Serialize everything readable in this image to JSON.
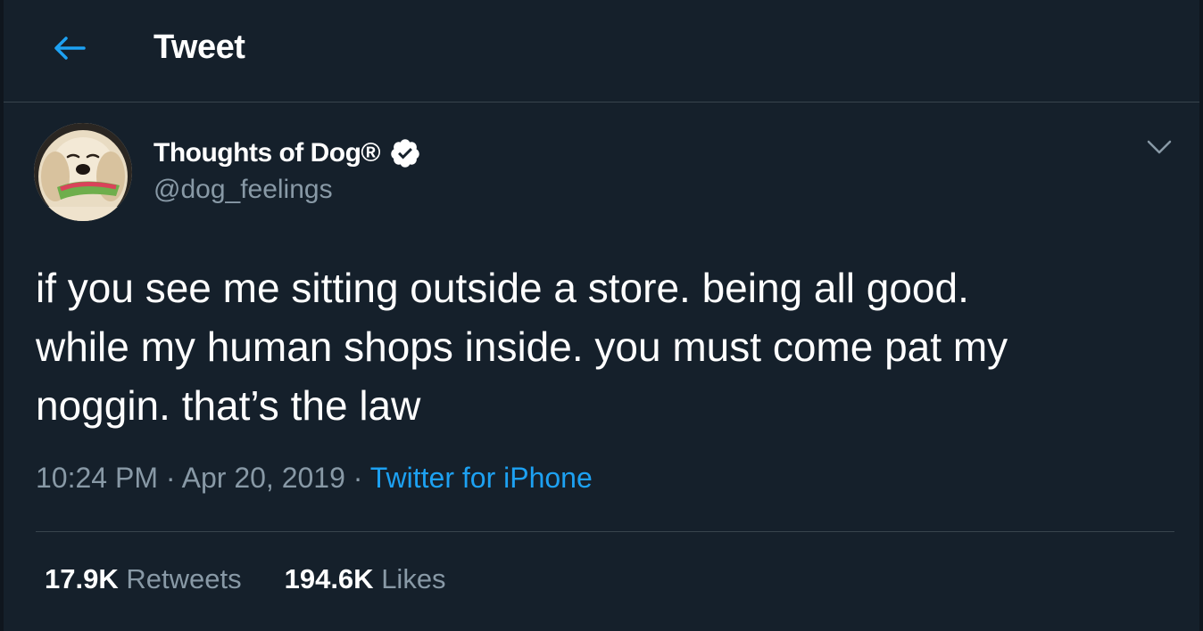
{
  "header": {
    "title": "Tweet",
    "back_icon": "arrow-left-icon"
  },
  "author": {
    "display_name": "Thoughts of Dog®",
    "handle": "@dog_feelings",
    "verified": true
  },
  "tweet": {
    "text": "if you see me sitting outside a store. being all good.\nwhile my human shops inside. you must come pat my\nnoggin. that’s the law",
    "time": "10:24 PM",
    "separator": "·",
    "date": "Apr 20, 2019",
    "source": "Twitter for iPhone"
  },
  "stats": {
    "retweets_count": "17.9K",
    "retweets_label": "Retweets",
    "likes_count": "194.6K",
    "likes_label": "Likes"
  },
  "colors": {
    "background": "#15202b",
    "accent": "#1da1f2",
    "secondary_text": "#8899a6",
    "border": "#38444d"
  }
}
